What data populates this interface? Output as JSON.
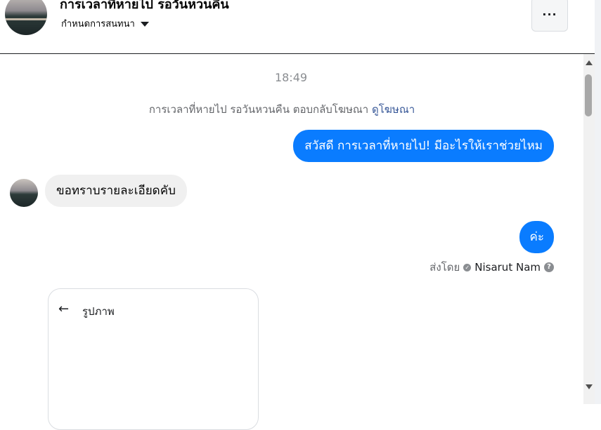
{
  "header": {
    "title": "การเวลาที่หายไป รอวันหวนคืน",
    "subtitle": "กำหนดการสนทนา",
    "more_label": "···"
  },
  "chat": {
    "timestamp": "18:49",
    "system_note": "การเวลาที่หายไป รอวันหวนคืน ตอบกลับโฆษณา",
    "system_link": "ดูโฆษณา",
    "messages": [
      {
        "direction": "out",
        "text": "สวัสดี การเวลาที่หายไป! มีอะไรให้เราช่วยไหม"
      },
      {
        "direction": "in",
        "text": "ขอทราบรายละเอียดคับ"
      },
      {
        "direction": "out",
        "text": "ค่ะ"
      }
    ],
    "sent_by_label": "ส่งโดย",
    "sender_name": "Nisarut Nam",
    "image_card": {
      "title": "รูปภาพ"
    }
  },
  "colors": {
    "outgoing_bubble": "#0a7cff",
    "incoming_bubble": "#f0f0f0",
    "link": "#385898"
  },
  "icons": {
    "more": "ellipsis-icon",
    "caret": "caret-down-icon",
    "check": "check-circle-icon",
    "help": "question-circle-icon",
    "back": "arrow-left-icon"
  }
}
